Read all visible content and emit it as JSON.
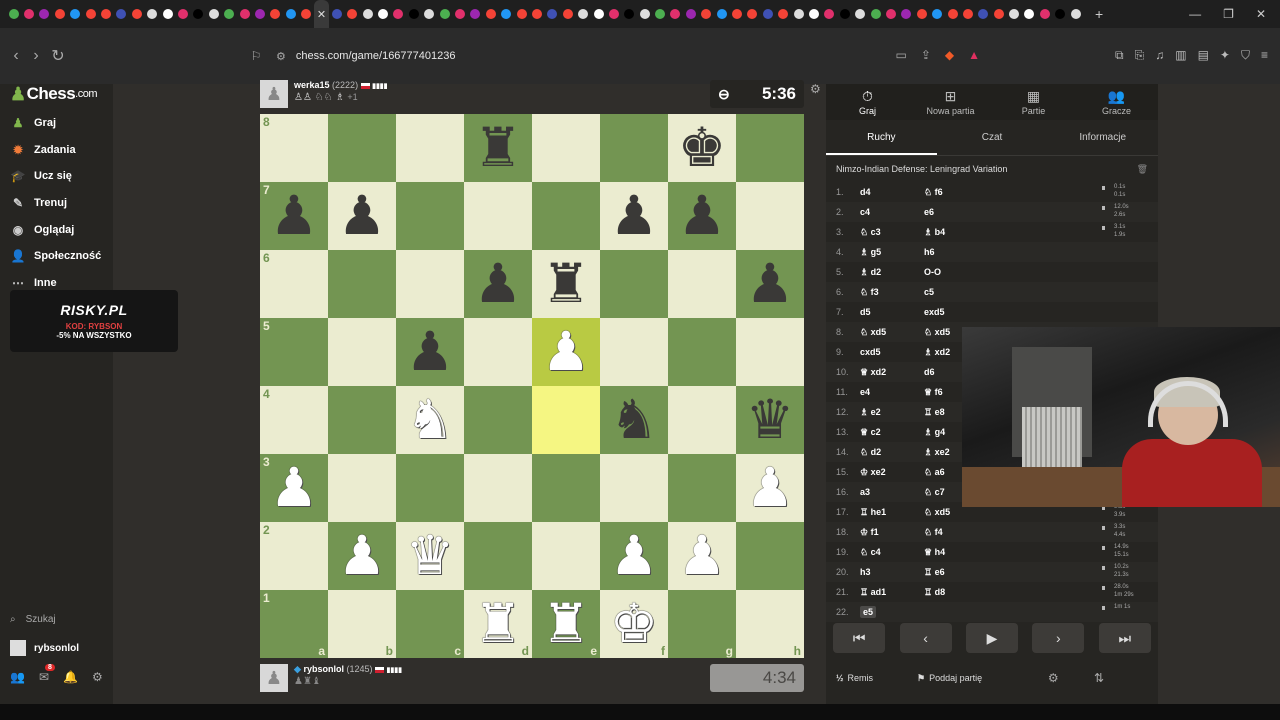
{
  "browser": {
    "url": "chess.com/game/166777401236",
    "active_tab_glyph": "✕",
    "new_tab_glyph": "+"
  },
  "sidebar": {
    "logo": "Chess",
    "logo_suffix": ".com",
    "items": [
      {
        "label": "Graj",
        "icon": "play-icon",
        "color": "#81b64c"
      },
      {
        "label": "Zadania",
        "icon": "puzzle-icon",
        "color": "#f07c3a"
      },
      {
        "label": "Ucz się",
        "icon": "learn-icon",
        "color": "#3aa0e0"
      },
      {
        "label": "Trenuj",
        "icon": "train-icon",
        "color": "#ccc"
      },
      {
        "label": "Oglądaj",
        "icon": "watch-icon",
        "color": "#ccc"
      },
      {
        "label": "Społeczność",
        "icon": "community-icon",
        "color": "#5aa0e0"
      },
      {
        "label": "Inne",
        "icon": "more-icon",
        "color": "#ccc"
      }
    ],
    "promo": {
      "brand": "RISKY.PL",
      "code": "KOD: RYBSON",
      "discount": "-5% NA WSZYSTKO"
    },
    "search_label": "Szukaj",
    "username": "rybsonlol",
    "message_badge": "8"
  },
  "top_player": {
    "name": "werka15",
    "rating": "(2222)",
    "bars": "▮▮▮▮",
    "captured": "♙♙ ♘♘ ♗",
    "advantage": "+1"
  },
  "bottom_player": {
    "name": "rybsonlol",
    "rating": "(1245)",
    "bars": "▮▮▮▮",
    "captured": "♟♜♝"
  },
  "clocks": {
    "top": "5:36",
    "bottom": "4:34"
  },
  "board": {
    "files": [
      "a",
      "b",
      "c",
      "d",
      "e",
      "f",
      "g",
      "h"
    ],
    "ranks": [
      "8",
      "7",
      "6",
      "5",
      "4",
      "3",
      "2",
      "1"
    ],
    "highlight": [
      "e5",
      "e4"
    ],
    "pieces": {
      "d8": "bR",
      "g8": "bK",
      "a7": "bP",
      "b7": "bP",
      "f7": "bP",
      "g7": "bP",
      "d6": "bP",
      "e6": "bR",
      "h6": "bP",
      "c5": "bP",
      "e5": "wP",
      "c4": "wN",
      "f4": "bN",
      "h4": "bQ",
      "a3": "wP",
      "h3": "wP",
      "b2": "wP",
      "c2": "wQ",
      "f2": "wP",
      "g2": "wP",
      "d1": "wR",
      "e1": "wR",
      "f1": "wK"
    }
  },
  "panel": {
    "tabs": [
      {
        "label": "Graj",
        "icon": "⏱"
      },
      {
        "label": "Nowa partia",
        "icon": "⊞"
      },
      {
        "label": "Partie",
        "icon": "▦"
      },
      {
        "label": "Gracze",
        "icon": "👥"
      }
    ],
    "subtabs": [
      "Ruchy",
      "Czat",
      "Informacje"
    ],
    "opening": "Nimzo-Indian Defense: Leningrad Variation",
    "moves": [
      {
        "n": "1.",
        "w": "d4",
        "b": "♘ f6",
        "t1": "0.1s",
        "t2": "0.1s"
      },
      {
        "n": "2.",
        "w": "c4",
        "b": "e6",
        "t1": "12.0s",
        "t2": "2.6s"
      },
      {
        "n": "3.",
        "w": "♘ c3",
        "b": "♗ b4",
        "t1": "3.1s",
        "t2": "1.9s"
      },
      {
        "n": "4.",
        "w": "♗ g5",
        "b": "h6",
        "t1": "",
        "t2": ""
      },
      {
        "n": "5.",
        "w": "♗ d2",
        "b": "O-O",
        "t1": "",
        "t2": ""
      },
      {
        "n": "6.",
        "w": "♘ f3",
        "b": "c5",
        "t1": "",
        "t2": ""
      },
      {
        "n": "7.",
        "w": "d5",
        "b": "exd5",
        "t1": "",
        "t2": ""
      },
      {
        "n": "8.",
        "w": "♘ xd5",
        "b": "♘ xd5",
        "t1": "",
        "t2": ""
      },
      {
        "n": "9.",
        "w": "cxd5",
        "b": "♗ xd2",
        "t1": "",
        "t2": ""
      },
      {
        "n": "10.",
        "w": "♕ xd2",
        "b": "d6",
        "t1": "",
        "t2": ""
      },
      {
        "n": "11.",
        "w": "e4",
        "b": "♕ f6",
        "t1": "",
        "t2": ""
      },
      {
        "n": "12.",
        "w": "♗ e2",
        "b": "♖ e8",
        "t1": "",
        "t2": ""
      },
      {
        "n": "13.",
        "w": "♕ c2",
        "b": "♗ g4",
        "t1": "24.5s",
        "t2": "37.5s"
      },
      {
        "n": "14.",
        "w": "♘ d2",
        "b": "♗ xe2",
        "t1": "33.1s",
        "t2": "6.6s"
      },
      {
        "n": "15.",
        "w": "♔ xe2",
        "b": "♘ a6",
        "t1": "0.1s",
        "t2": "1.4s"
      },
      {
        "n": "16.",
        "w": "a3",
        "b": "♘ c7",
        "t1": "5.7s",
        "t2": "21.9s"
      },
      {
        "n": "17.",
        "w": "♖ he1",
        "b": "♘ xd5",
        "t1": "9.8s",
        "t2": "3.9s"
      },
      {
        "n": "18.",
        "w": "♔ f1",
        "b": "♘ f4",
        "t1": "3.3s",
        "t2": "4.4s"
      },
      {
        "n": "19.",
        "w": "♘ c4",
        "b": "♕ h4",
        "t1": "14.9s",
        "t2": "15.1s"
      },
      {
        "n": "20.",
        "w": "h3",
        "b": "♖ e6",
        "t1": "10.2s",
        "t2": "21.3s"
      },
      {
        "n": "21.",
        "w": "♖ ad1",
        "b": "♖ d8",
        "t1": "28.0s",
        "t2": "1m 29s"
      },
      {
        "n": "22.",
        "w": "e5",
        "b": "",
        "t1": "1m 1s",
        "t2": ""
      }
    ],
    "footer": {
      "draw": "Remis",
      "resign": "Poddaj partię"
    }
  }
}
